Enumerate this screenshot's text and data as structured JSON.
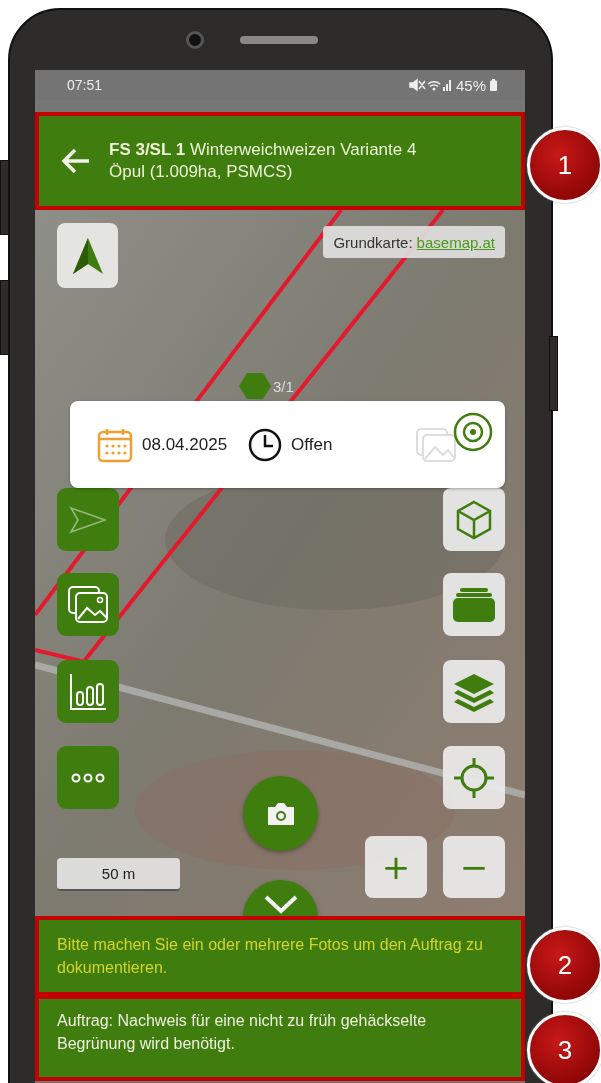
{
  "status_bar": {
    "time": "07:51",
    "battery": "45%"
  },
  "header": {
    "title": "**FS 3/SL 1** Winterweichweizen Variante 4",
    "subtitle": "Öpul (1.009ha, PSMCS)"
  },
  "map": {
    "attribution_label": "Grundkarte:",
    "attribution_link": "basemap.at",
    "field_label": "3/1",
    "scale": "50 m"
  },
  "info_card": {
    "date": "08.04.2025",
    "status": "Offen"
  },
  "left_buttons": [
    {
      "kind": "send",
      "disabled": true
    },
    {
      "kind": "gallery",
      "disabled": false
    },
    {
      "kind": "chart",
      "disabled": false
    },
    {
      "kind": "more",
      "disabled": false
    }
  ],
  "right_buttons": [
    {
      "kind": "cube"
    },
    {
      "kind": "stack"
    },
    {
      "kind": "layers"
    },
    {
      "kind": "locate"
    }
  ],
  "zoom": {
    "plus": "+",
    "minus": "−"
  },
  "messages": [
    {
      "kind": "hint",
      "text": "Bitte machen Sie ein oder mehrere Fotos um den Auftrag zu dokumentieren."
    },
    {
      "kind": "task",
      "text": "Auftrag: Nachweis für eine nicht zu früh gehäckselte Begrünung wird benötigt."
    }
  ],
  "callouts": [
    "1",
    "2",
    "3"
  ]
}
